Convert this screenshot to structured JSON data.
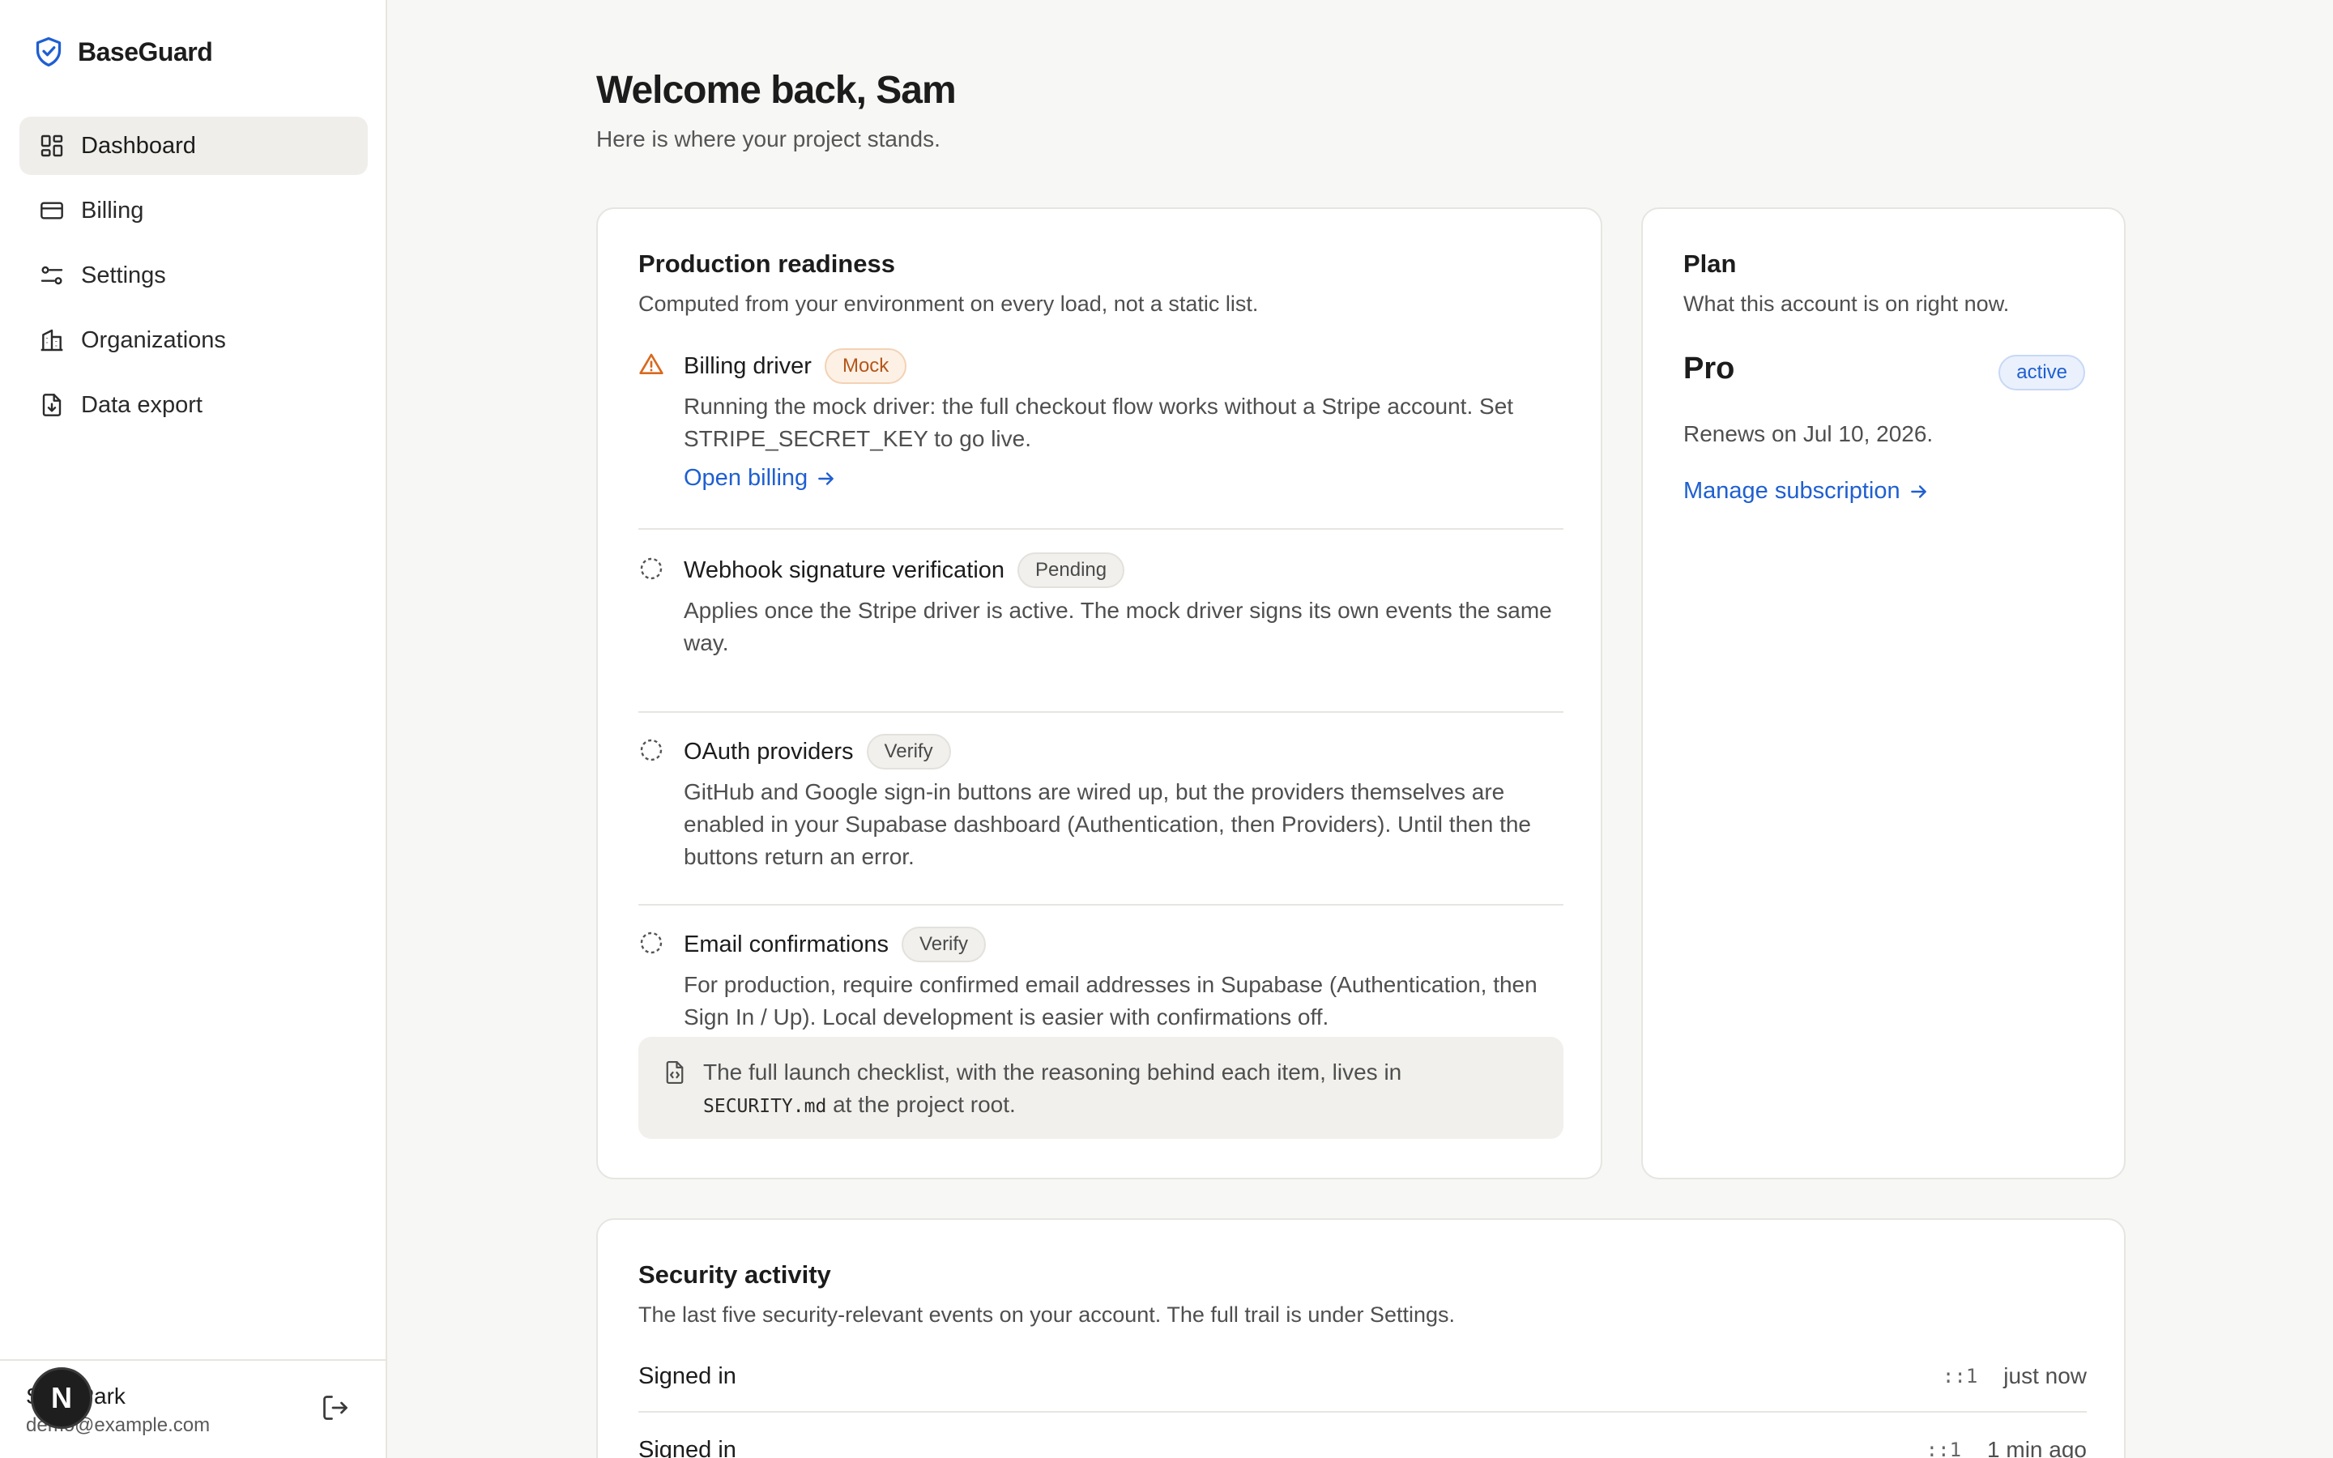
{
  "app": {
    "name": "BaseGuard"
  },
  "sidebar": {
    "items": [
      {
        "label": "Dashboard",
        "icon": "dashboard-icon",
        "active": true
      },
      {
        "label": "Billing",
        "icon": "credit-card-icon"
      },
      {
        "label": "Settings",
        "icon": "sliders-icon"
      },
      {
        "label": "Organizations",
        "icon": "building-icon"
      },
      {
        "label": "Data export",
        "icon": "file-download-icon"
      }
    ],
    "user": {
      "name": "Sam Park",
      "email": "demo@example.com",
      "avatar_letter": "N"
    }
  },
  "header": {
    "title": "Welcome back, Sam",
    "subtitle": "Here is where your project stands."
  },
  "readiness": {
    "title": "Production readiness",
    "subtitle": "Computed from your environment on every load, not a static list.",
    "checks": [
      {
        "title": "Billing driver",
        "badge": "Mock",
        "icon": "warning-icon",
        "desc": "Running the mock driver: the full checkout flow works without a Stripe account. Set STRIPE_SECRET_KEY to go live.",
        "link": "Open billing"
      },
      {
        "title": "Webhook signature verification",
        "badge": "Pending",
        "icon": "pending-circle-icon",
        "desc": "Applies once the Stripe driver is active. The mock driver signs its own events the same way."
      },
      {
        "title": "OAuth providers",
        "badge": "Verify",
        "icon": "pending-circle-icon",
        "desc": "GitHub and Google sign-in buttons are wired up, but the providers themselves are enabled in your Supabase dashboard (Authentication, then Providers). Until then the buttons return an error."
      },
      {
        "title": "Email confirmations",
        "badge": "Verify",
        "icon": "pending-circle-icon",
        "desc": "For production, require confirmed email addresses in Supabase (Authentication, then Sign In / Up). Local development is easier with confirmations off."
      }
    ],
    "note": {
      "text_before": "The full launch checklist, with the reasoning behind each item, lives in",
      "code": "SECURITY.md",
      "text_after": "at the project root."
    }
  },
  "plan": {
    "title": "Plan",
    "subtitle": "What this account is on right now.",
    "name": "Pro",
    "status": "active",
    "renews": "Renews on Jul 10, 2026.",
    "link": "Manage subscription"
  },
  "activity": {
    "title": "Security activity",
    "subtitle": "The last five security-relevant events on your account. The full trail is under Settings.",
    "rows": [
      {
        "label": "Signed in",
        "ip": "::1",
        "time": "just now"
      },
      {
        "label": "Signed in",
        "ip": "::1",
        "time": "1 min ago"
      }
    ]
  },
  "colors": {
    "accent": "#1f5fd1",
    "warning": "#d9681e",
    "background": "#f7f7f5",
    "sidebar_active": "#efeeea"
  }
}
